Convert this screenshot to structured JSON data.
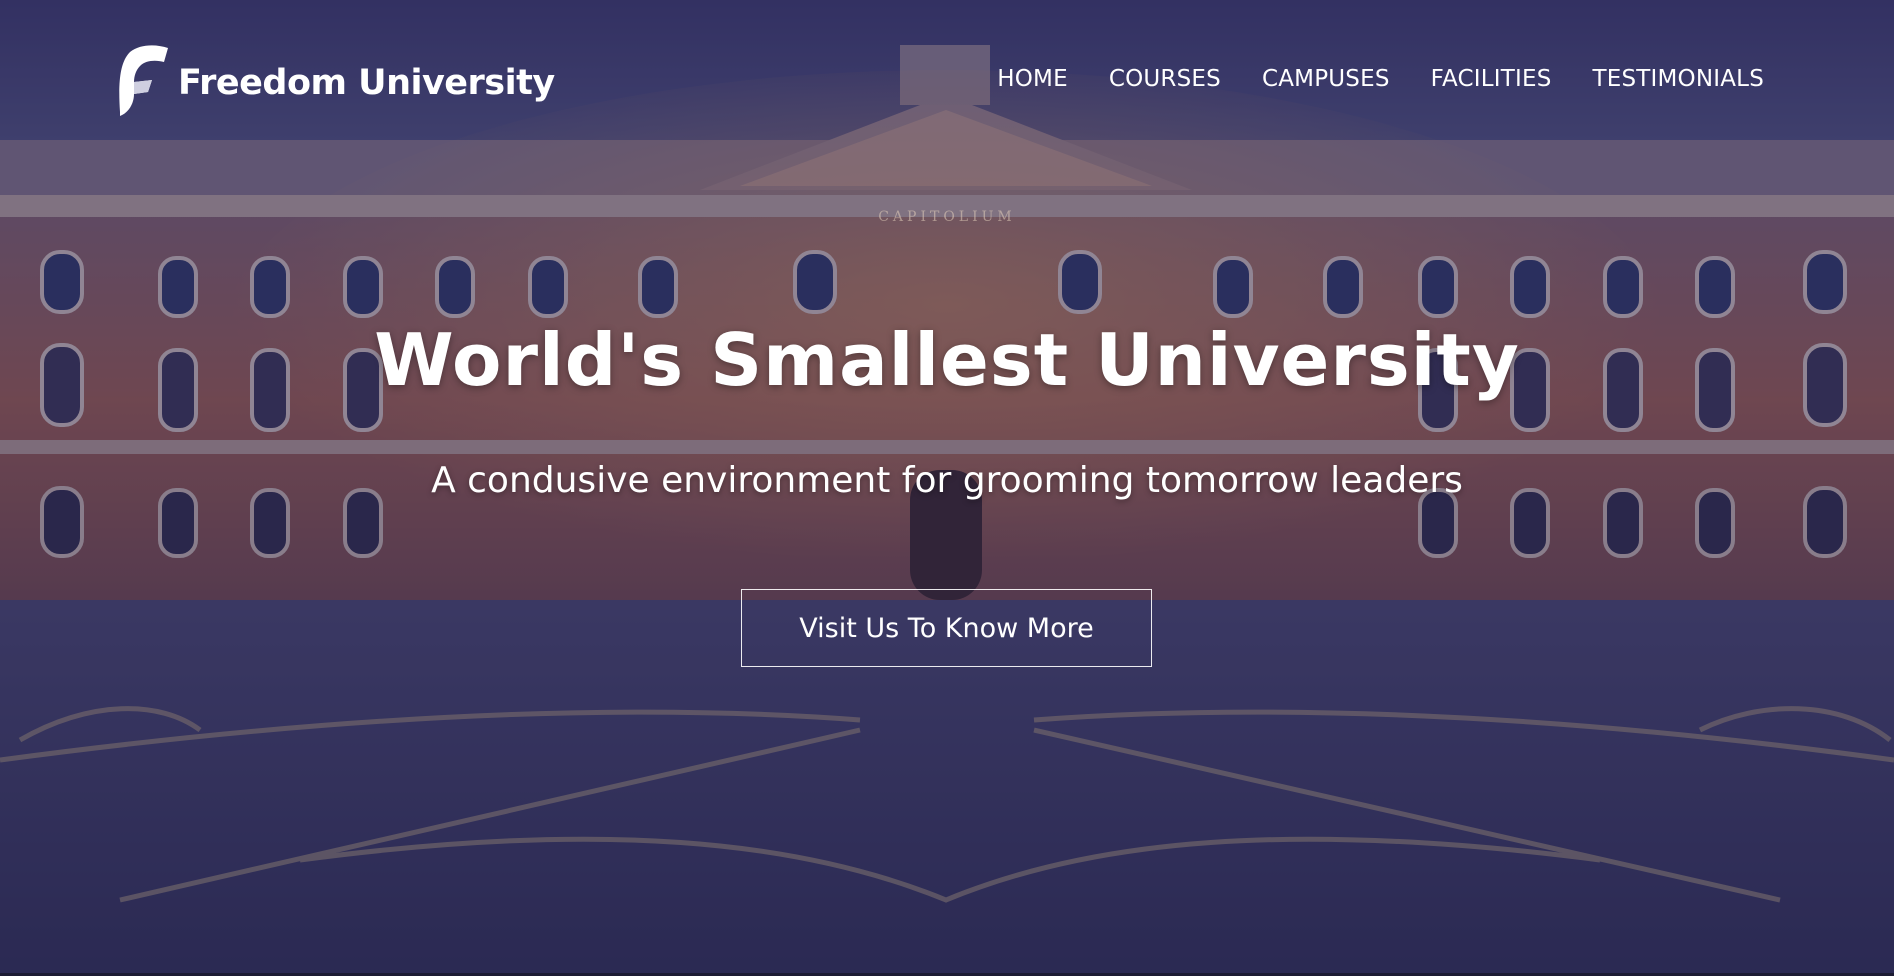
{
  "brand": {
    "name": "Freedom University",
    "logo_icon": "freedom-f-logo-icon"
  },
  "nav": {
    "items": [
      {
        "label": "HOME"
      },
      {
        "label": "COURSES"
      },
      {
        "label": "CAMPUSES"
      },
      {
        "label": "FACILITIES"
      },
      {
        "label": "TESTIMONIALS"
      }
    ]
  },
  "hero": {
    "title": "World's Smallest University",
    "subtitle": "A condusive environment for grooming tomorrow leaders",
    "cta_label": "Visit Us To Know More",
    "building_inscription": "CAPITOLIUM"
  },
  "colors": {
    "overlay": "#2b2a4d",
    "text": "#ffffff",
    "facade": "#b06a4e",
    "plaza": "#3a3a5e"
  }
}
